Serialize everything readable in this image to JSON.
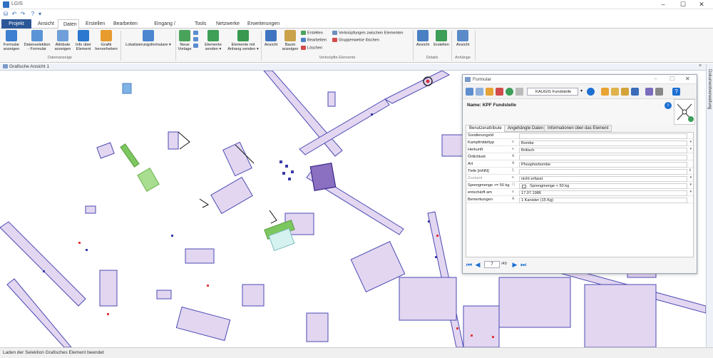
{
  "window": {
    "title": "LGIS",
    "min_icon": "minimize-icon",
    "max_icon": "maximize-icon",
    "close_icon": "close-icon"
  },
  "tabs": {
    "file": "Projekt",
    "items": [
      "Ansicht",
      "Daten",
      "Erstellen",
      "Bearbeiten",
      "Eingang / Ausgang",
      "Tools",
      "Netzwerke",
      "Erweiterungen"
    ],
    "active": "Daten"
  },
  "ribbon": {
    "formular_anzeigen": "Formular anzeigen",
    "datenselektion": "Datenselektion - Formular",
    "attribute_anzeigen": "Attribute anzeigen",
    "info_element": "Info über Element",
    "grafik_hervorheben": "Grafik hervorheben",
    "group_datenanzeige": "Datenanzeige",
    "lokalisierungsformulare": "Lokalisierungsformulare",
    "neue_vorlage": "Neue Vorlage",
    "elemente_senden": "Elemente senden",
    "elemente_mit_anhang": "Elemente mit Anhang senden",
    "ansicht1": "Ansicht",
    "baum_anzeigen": "Baum anzeigen",
    "erstellen": "Erstellen",
    "bearbeiten": "Bearbeiten",
    "loeschen": "Löschen",
    "verknuepfungen": "Verknüpfungen zwischen Elementen",
    "gruppenweise": "Gruppenweise löschen",
    "group_verknuepfte": "Verknüpfte Elemente",
    "ansicht2": "Ansicht",
    "erstellen2": "Erstellen",
    "group_details": "Details",
    "ansicht3": "Ansicht",
    "group_anhaenge": "Anhänge"
  },
  "doc": {
    "title": "Grafische Ansicht 1",
    "right_panel": "Dokumentverwaltung"
  },
  "status": {
    "text": "Laden der Selektion Grafisches Element beendet"
  },
  "form": {
    "title": "Formular",
    "select_value": "KAUGIS Fundstelle",
    "name_label": "Name:",
    "name_value": "KPF Fundstelle",
    "tabs": [
      "Benutzerattribute",
      "Angehängte Daten",
      "Informationen über das Element"
    ],
    "rows": [
      {
        "label": "SondierungsId",
        "value": ""
      },
      {
        "label": "Kampfmitteltyp",
        "value": "Bombe"
      },
      {
        "label": "Herkunft",
        "value": "Britisch"
      },
      {
        "label": "Örtlichkeit",
        "value": ""
      },
      {
        "label": "Art",
        "value": "Phosphorbombe"
      },
      {
        "label": "Tiefe [mNN]",
        "value": ""
      },
      {
        "label": "Zustand",
        "value": "nicht erfasst"
      },
      {
        "label": "Sprengmenge >= 50 kg",
        "value": "Sprengmenge < 50 kg"
      },
      {
        "label": "entschärft am",
        "value": "17.07.1986"
      },
      {
        "label": "Bemerkungen",
        "value": "1 Kanister (15 Kg)"
      }
    ],
    "nav_record": "7",
    "nav_of": "/49"
  },
  "colors": {
    "accent": "#2b5797",
    "parcel_fill": "#e3d6f1",
    "parcel_stroke": "#4b4bb3",
    "highlight_green": "#7cc75f"
  }
}
